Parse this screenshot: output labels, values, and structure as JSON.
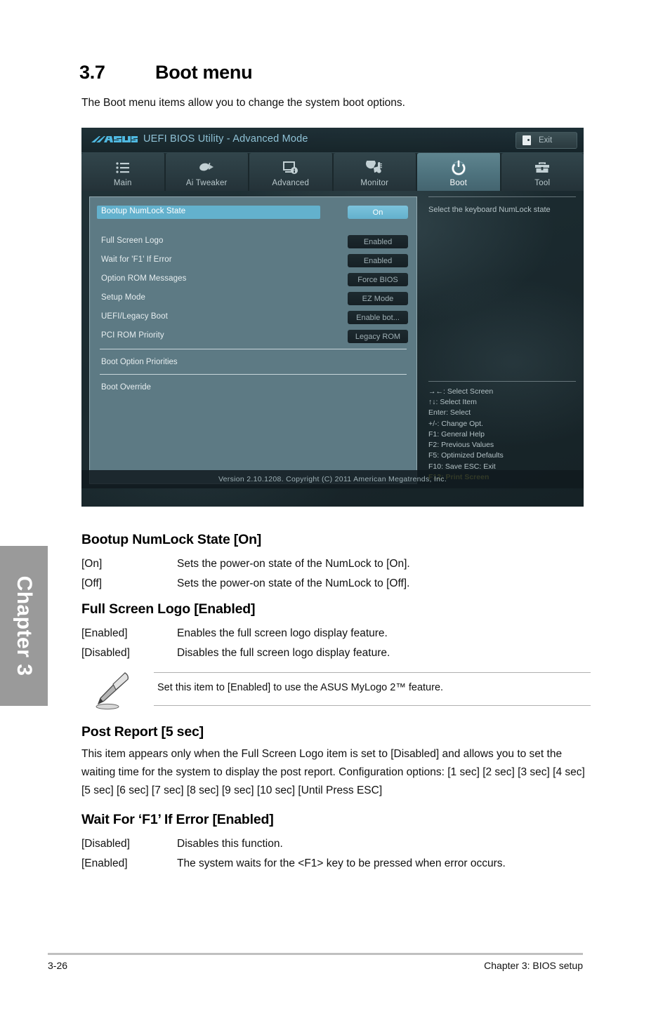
{
  "chapter_tab": {
    "label": "Chapter 3"
  },
  "heading": {
    "number": "3.7",
    "title": "Boot menu"
  },
  "intro": "The Boot menu items allow you to change the system boot options.",
  "bios": {
    "logo": "asus-logo",
    "title": "UEFI BIOS Utility - Advanced Mode",
    "exit_label": "Exit",
    "tabs": [
      {
        "label": "Main",
        "icon": "list-icon",
        "active": false
      },
      {
        "label": "Ai  Tweaker",
        "icon": "tweaker-icon",
        "active": false
      },
      {
        "label": "Advanced",
        "icon": "monitor-info-icon",
        "active": false
      },
      {
        "label": "Monitor",
        "icon": "fan-thermometer-icon",
        "active": false
      },
      {
        "label": "Boot",
        "icon": "power-icon",
        "active": true
      },
      {
        "label": "Tool",
        "icon": "toolbox-icon",
        "active": false
      }
    ],
    "settings": [
      {
        "label": "Bootup NumLock State",
        "value": "On",
        "selected": true
      },
      {
        "label": "Full Screen Logo",
        "value": "Enabled",
        "selected": false
      },
      {
        "label": "Wait for 'F1' If Error",
        "value": "Enabled",
        "selected": false
      },
      {
        "label": "Option ROM Messages",
        "value": "Force BIOS",
        "selected": false
      },
      {
        "label": "Setup Mode",
        "value": "EZ Mode",
        "selected": false
      },
      {
        "label": "UEFI/Legacy Boot",
        "value": "Enable bot...",
        "selected": false
      },
      {
        "label": "PCI ROM Priority",
        "value": "Legacy ROM",
        "selected": false
      }
    ],
    "sections": [
      {
        "label": "Boot Option Priorities"
      },
      {
        "label": "Boot Override"
      }
    ],
    "help_text": "Select the keyboard NumLock state",
    "legend": [
      {
        "text": "→←:  Select Screen",
        "highlight": false
      },
      {
        "text": "↑↓:  Select Item",
        "highlight": false
      },
      {
        "text": "Enter:  Select",
        "highlight": false
      },
      {
        "text": "+/-:  Change Opt.",
        "highlight": false
      },
      {
        "text": "F1:  General Help",
        "highlight": false
      },
      {
        "text": "F2:  Previous Values",
        "highlight": false
      },
      {
        "text": "F5:  Optimized Defaults",
        "highlight": false
      },
      {
        "text": "F10:  Save    ESC:  Exit",
        "highlight": false
      },
      {
        "text": "F12: Print Screen",
        "highlight": true
      }
    ],
    "footer": "Version  2.10.1208.   Copyright  (C)  2011  American  Megatrends,  Inc."
  },
  "sections": {
    "numlock": {
      "heading": "Bootup NumLock State [On]",
      "rows": [
        {
          "term": "[On]",
          "desc": "Sets the power-on state of the NumLock to [On]."
        },
        {
          "term": "[Off]",
          "desc": "Sets the power-on state of the NumLock to [Off]."
        }
      ]
    },
    "fullscreen": {
      "heading": "Full Screen Logo [Enabled]",
      "rows": [
        {
          "term": "[Enabled]",
          "desc": "Enables the full screen logo display feature."
        },
        {
          "term": "[Disabled]",
          "desc": "Disables the full screen logo display feature."
        }
      ]
    },
    "note": {
      "icon": "pencil-note-icon",
      "text": "Set this item to [Enabled] to use the ASUS MyLogo 2™ feature."
    },
    "postreport": {
      "heading": "Post Report [5 sec]",
      "paragraph": "This item appears only when the Full Screen Logo item is set to [Disabled] and allows you to set the waiting time for the system to display the post report. Configuration options: [1 sec] [2 sec] [3 sec] [4 sec] [5 sec] [6 sec] [7 sec] [8 sec] [9 sec] [10 sec] [Until Press ESC]"
    },
    "waitf1": {
      "heading": "Wait For ‘F1’ If Error [Enabled]",
      "rows": [
        {
          "term": "[Disabled]",
          "desc": "Disables this function."
        },
        {
          "term": "[Enabled]",
          "desc": "The system waits for the <F1> key to be pressed when error occurs."
        }
      ]
    }
  },
  "page_footer": {
    "page_number": "3-26",
    "right": "Chapter 3: BIOS setup"
  },
  "colors": {
    "accent_selected": "#63b1cd",
    "panel": "#5d7a84",
    "highlight_key": "#e9e45a",
    "chapter_tab": "#9a9a9a"
  }
}
